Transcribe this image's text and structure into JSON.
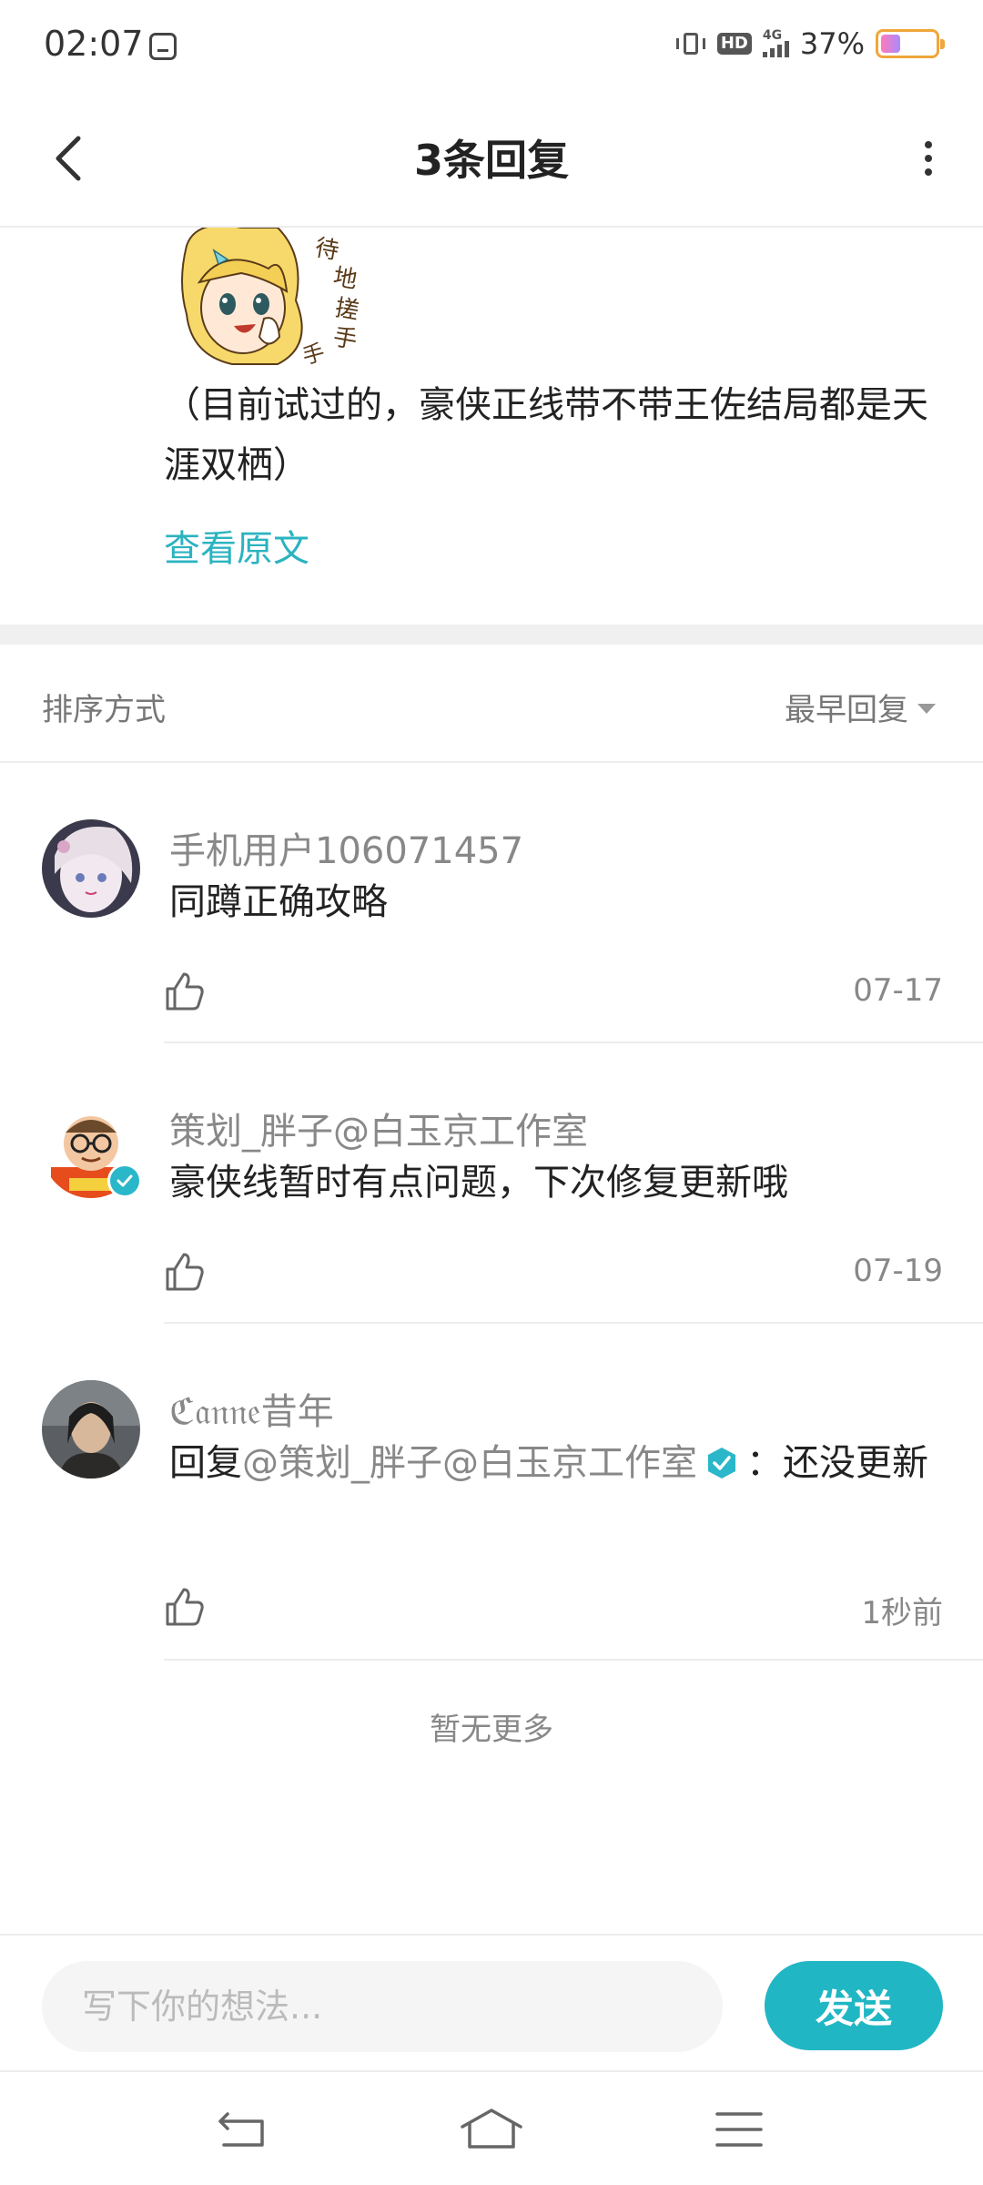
{
  "status_bar": {
    "time": "02:07",
    "hd_label": "HD",
    "network_label": "4G",
    "battery_text": "37%",
    "battery_level": 0.37
  },
  "header": {
    "title": "3条回复"
  },
  "post": {
    "text": "（目前试过的，豪侠正线带不带王佐结局都是天涯双栖）",
    "view_original": "查看原文"
  },
  "sort": {
    "label": "排序方式",
    "value": "最早回复"
  },
  "comments": [
    {
      "username": "手机用户106071457",
      "text": "同蹲正确攻略",
      "date": "07-17",
      "verified": false
    },
    {
      "username": "策划_胖子@白玉京工作室",
      "text": "豪侠线暂时有点问题，下次修复更新哦",
      "date": "07-19",
      "verified": true
    },
    {
      "username": "ℭ𝔞𝔫𝔫𝔢昔年",
      "reply_prefix": "回复",
      "mention": "@策划_胖子@白玉京工作室",
      "text": "：还没更新",
      "date": "1秒前",
      "verified": false
    }
  ],
  "no_more": "暂无更多",
  "input": {
    "placeholder": "写下你的想法...",
    "send_label": "发送"
  },
  "colors": {
    "accent": "#21b6c4",
    "link": "#2bb3c0",
    "secondary_text": "#888888"
  }
}
